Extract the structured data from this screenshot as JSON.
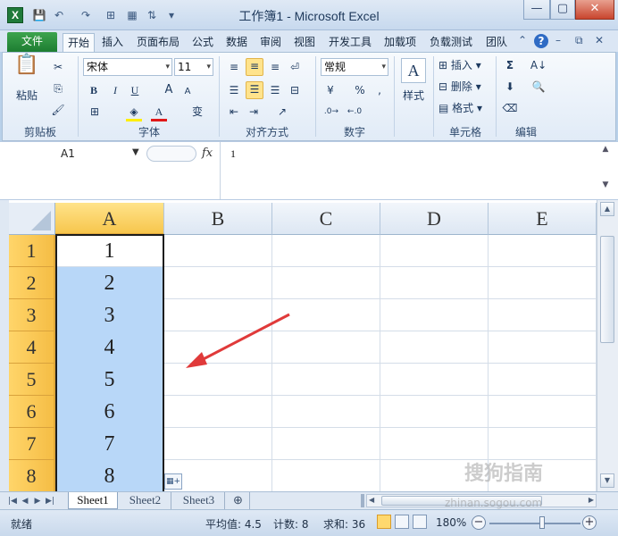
{
  "window": {
    "title": "工作簿1 - Microsoft Excel",
    "app_icon_letter": "X",
    "minimize": "—",
    "restore": "▢",
    "close": "✕"
  },
  "ribbon_tabs": [
    "文件",
    "开始",
    "插入",
    "页面布局",
    "公式",
    "数据",
    "审阅",
    "视图",
    "开发工具",
    "加载项",
    "负载测试",
    "团队"
  ],
  "active_tab": "开始",
  "clipboard": {
    "paste": "粘贴",
    "label": "剪贴板"
  },
  "font": {
    "name": "宋体",
    "size": "11",
    "bold": "B",
    "italic": "I",
    "underline": "U",
    "grow": "A",
    "shrink": "A",
    "phonetic": "变",
    "label": "字体"
  },
  "alignment": {
    "label": "对齐方式"
  },
  "number": {
    "format": "常规",
    "percent": "%",
    "comma": ",",
    "label": "数字"
  },
  "styles": {
    "label": "样式"
  },
  "cells": {
    "insert": "插入",
    "delete": "删除",
    "format": "格式",
    "label": "单元格"
  },
  "editing": {
    "sum": "Σ",
    "label": "编辑"
  },
  "formula_bar": {
    "name_box": "A1",
    "fx": "fx",
    "value": "1"
  },
  "columns": [
    "A",
    "B",
    "C",
    "D",
    "E"
  ],
  "selected_column": "A",
  "rows": [
    {
      "n": "1",
      "a": "1"
    },
    {
      "n": "2",
      "a": "2"
    },
    {
      "n": "3",
      "a": "3"
    },
    {
      "n": "4",
      "a": "4"
    },
    {
      "n": "5",
      "a": "5"
    },
    {
      "n": "6",
      "a": "6"
    },
    {
      "n": "7",
      "a": "7"
    },
    {
      "n": "8",
      "a": "8"
    }
  ],
  "sheets": [
    "Sheet1",
    "Sheet2",
    "Sheet3"
  ],
  "active_sheet": "Sheet1",
  "status": {
    "mode": "就绪",
    "average": "平均值: 4.5",
    "count": "计数: 8",
    "sum": "求和: 36",
    "zoom": "180%"
  },
  "watermark": {
    "text": "搜狗指南",
    "url": "zhinan.sogou.com"
  },
  "colors": {
    "selection_tint": "#b8d7f8",
    "header_highlight": "#f5bd45",
    "arrow": "#e03a3a",
    "file_tab": "#1d7d31"
  }
}
